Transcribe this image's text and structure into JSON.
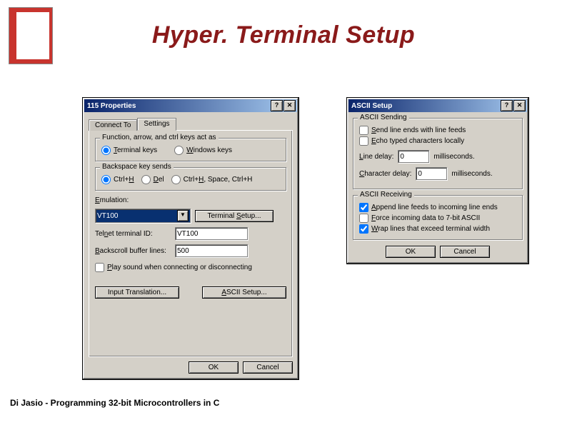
{
  "slide": {
    "title": "Hyper. Terminal Setup",
    "footer": "Di Jasio - Programming 32-bit Microcontrollers in C"
  },
  "dialog1": {
    "title": "115 Properties",
    "tabs": {
      "connect": "Connect To",
      "settings": "Settings"
    },
    "group1": {
      "title": "Function, arrow, and ctrl keys act as",
      "opt1": "Terminal keys",
      "opt2": "Windows keys"
    },
    "group2": {
      "title": "Backspace key sends",
      "opt1": "Ctrl+H",
      "opt2": "Del",
      "opt3": "Ctrl+H, Space, Ctrl+H"
    },
    "emulation_label": "Emulation:",
    "emulation_value": "VT100",
    "terminal_setup_btn": "Terminal Setup...",
    "telnet_label": "Telnet terminal ID:",
    "telnet_value": "VT100",
    "backscroll_label": "Backscroll buffer lines:",
    "backscroll_value": "500",
    "playsound": "Play sound when connecting or disconnecting",
    "input_trans_btn": "Input Translation...",
    "ascii_setup_btn": "ASCII Setup...",
    "ok": "OK",
    "cancel": "Cancel"
  },
  "dialog2": {
    "title": "ASCII Setup",
    "sending": {
      "title": "ASCII Sending",
      "opt1": "Send line ends with line feeds",
      "opt2": "Echo typed characters locally",
      "line_delay_label": "Line delay:",
      "line_delay_value": "0",
      "line_delay_unit": "milliseconds.",
      "char_delay_label": "Character delay:",
      "char_delay_value": "0",
      "char_delay_unit": "milliseconds."
    },
    "receiving": {
      "title": "ASCII Receiving",
      "opt1": "Append line feeds to incoming line ends",
      "opt2": "Force incoming data to 7-bit ASCII",
      "opt3": "Wrap lines that exceed terminal width"
    },
    "ok": "OK",
    "cancel": "Cancel"
  }
}
